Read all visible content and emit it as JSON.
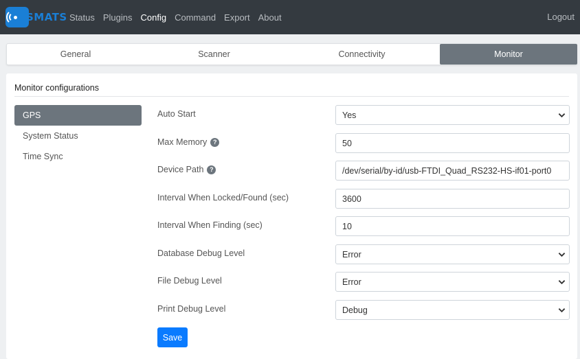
{
  "app": {
    "logo_text": "SMATS"
  },
  "navbar": {
    "links": [
      "Status",
      "Plugins",
      "Config",
      "Command",
      "Export",
      "About"
    ],
    "active": "Config",
    "logout": "Logout"
  },
  "tabs": [
    "General",
    "Scanner",
    "Connectivity",
    "Monitor"
  ],
  "active_tab": "Monitor",
  "card": {
    "title": "Monitor configurations"
  },
  "sidenav": {
    "items": [
      "GPS",
      "System Status",
      "Time Sync"
    ],
    "active": "GPS"
  },
  "form": {
    "auto_start": {
      "label": "Auto Start",
      "value": "Yes"
    },
    "max_memory": {
      "label": "Max Memory",
      "value": "50"
    },
    "device_path": {
      "label": "Device Path",
      "value": "/dev/serial/by-id/usb-FTDI_Quad_RS232-HS-if01-port0"
    },
    "interval_locked": {
      "label": "Interval When Locked/Found (sec)",
      "value": "3600"
    },
    "interval_finding": {
      "label": "Interval When Finding (sec)",
      "value": "10"
    },
    "db_debug": {
      "label": "Database Debug Level",
      "value": "Error"
    },
    "file_debug": {
      "label": "File Debug Level",
      "value": "Error"
    },
    "print_debug": {
      "label": "Print Debug Level",
      "value": "Debug"
    }
  },
  "help_icon_glyph": "?",
  "save_label": "Save",
  "colors": {
    "navbar": "#343a40",
    "active_tab": "#6c757d",
    "primary": "#0a7bff",
    "logo": "#1a7fd6"
  }
}
